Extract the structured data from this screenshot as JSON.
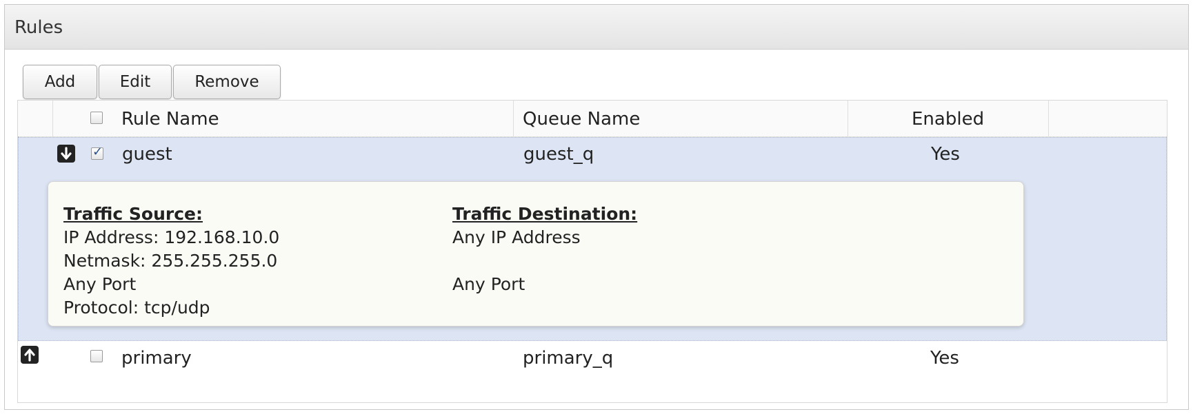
{
  "panel": {
    "title": "Rules"
  },
  "toolbar": {
    "add_label": "Add",
    "edit_label": "Edit",
    "remove_label": "Remove"
  },
  "table": {
    "columns": {
      "rule_name": "Rule Name",
      "queue_name": "Queue Name",
      "enabled": "Enabled"
    },
    "rows": [
      {
        "rule_name": "guest",
        "queue_name": "guest_q",
        "enabled": "Yes",
        "checked": true,
        "arrow_icon": "arrow-down-icon",
        "details": {
          "source_heading": "Traffic Source:",
          "source_lines": [
            "IP Address: 192.168.10.0",
            "Netmask: 255.255.255.0",
            "Any Port",
            "Protocol: tcp/udp"
          ],
          "dest_heading": "Traffic Destination:",
          "dest_lines": [
            "Any IP Address",
            "",
            "Any Port"
          ]
        }
      },
      {
        "rule_name": "primary",
        "queue_name": "primary_q",
        "enabled": "Yes",
        "checked": false,
        "arrow_icon": "arrow-up-icon"
      }
    ]
  },
  "colors": {
    "selected_row": "#dde5f4",
    "details_bg": "#fbfbf6",
    "arrow_bg": "#232323"
  }
}
